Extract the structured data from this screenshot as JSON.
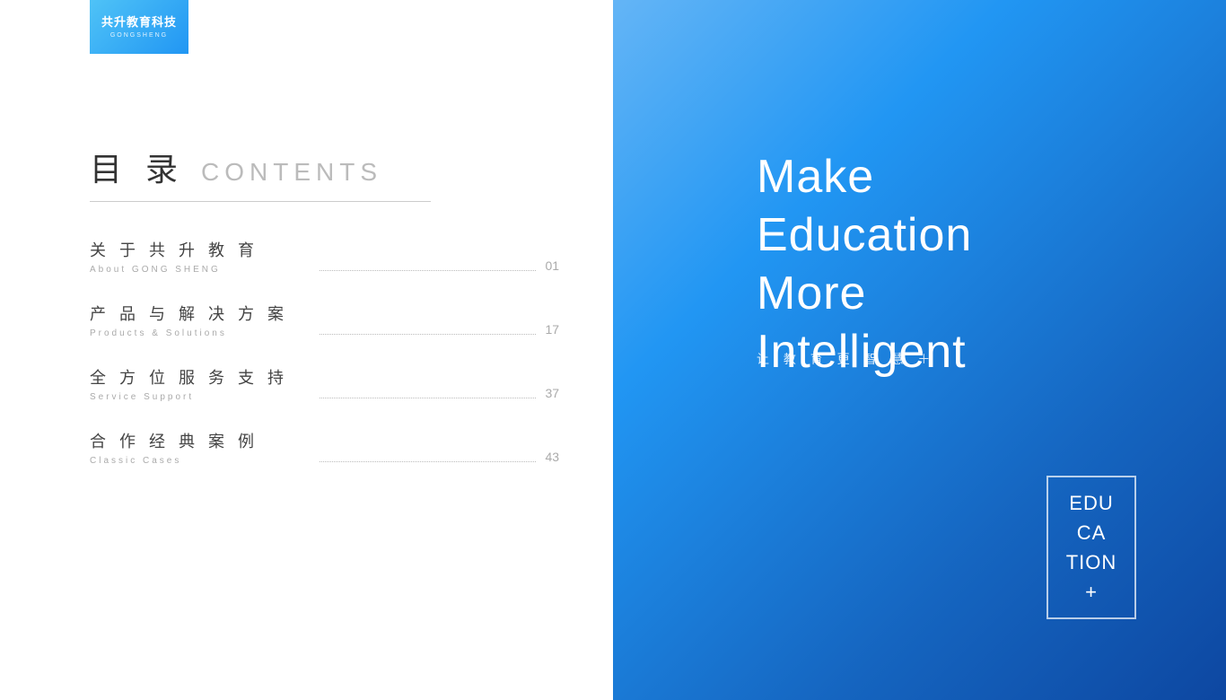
{
  "left": {
    "logo": {
      "chinese": "共升教育科技",
      "pinyin": "GONGSHENG"
    },
    "header": {
      "chinese": "目  录",
      "english": "CONTENTS"
    },
    "toc": [
      {
        "chinese": "关 于 共 升 教 育",
        "english": "About GONG SHENG",
        "number": "01"
      },
      {
        "chinese": "产 品 与 解 决 方 案",
        "english": "Products & Solutions",
        "number": "17"
      },
      {
        "chinese": "全 方 位 服 务 支 持",
        "english": "Service Support",
        "number": "37"
      },
      {
        "chinese": "合 作 经 典 案 例",
        "english": "Classic Cases",
        "number": "43"
      }
    ]
  },
  "right": {
    "tagline_line1": "Make",
    "tagline_line2": "Education",
    "tagline_line3": "More",
    "tagline_line4": "Intelligent",
    "tagline_chinese": "让 教 育 更 智 慧 ＋",
    "edu_box": "EDU\nCA\nTION\n+"
  }
}
